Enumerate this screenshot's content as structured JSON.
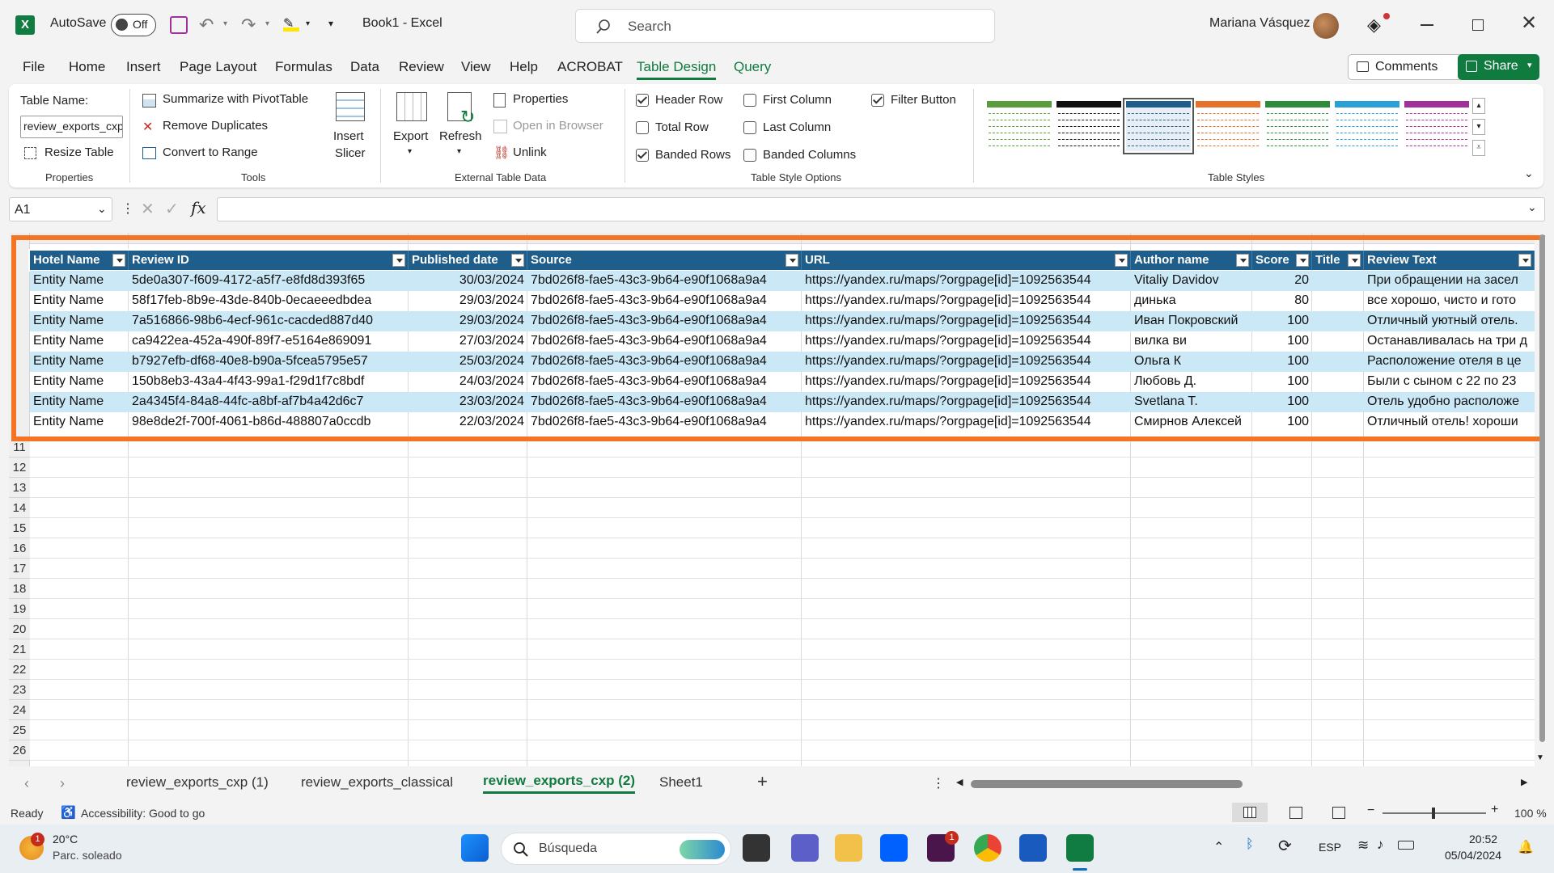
{
  "titlebar": {
    "autosave_label": "AutoSave",
    "autosave_state": "Off",
    "doc_title": "Book1  -  Excel",
    "search_placeholder": "Search",
    "user_name": "Mariana Vásquez"
  },
  "menu": {
    "items": [
      "File",
      "Home",
      "Insert",
      "Page Layout",
      "Formulas",
      "Data",
      "Review",
      "View",
      "Help",
      "ACROBAT",
      "Table Design",
      "Query"
    ],
    "active": "Table Design",
    "comments_label": "Comments",
    "share_label": "Share"
  },
  "ribbon": {
    "properties": {
      "table_name_label": "Table Name:",
      "table_name_value": "review_exports_cxp",
      "resize_label": "Resize Table",
      "group_label": "Properties"
    },
    "tools": {
      "summarize_label": "Summarize with PivotTable",
      "remove_dup_label": "Remove Duplicates",
      "convert_label": "Convert to Range",
      "insert_slicer_line1": "Insert",
      "insert_slicer_line2": "Slicer",
      "group_label": "Tools"
    },
    "external": {
      "export_label": "Export",
      "refresh_label": "Refresh",
      "properties_label": "Properties",
      "open_browser_label": "Open in Browser",
      "unlink_label": "Unlink",
      "group_label": "External Table Data"
    },
    "style_options": {
      "header_row": "Header Row",
      "total_row": "Total Row",
      "banded_rows": "Banded Rows",
      "first_column": "First Column",
      "last_column": "Last Column",
      "banded_columns": "Banded Columns",
      "filter_button": "Filter Button",
      "group_label": "Table Style Options",
      "checked": {
        "header_row": true,
        "total_row": false,
        "banded_rows": true,
        "first_column": false,
        "last_column": false,
        "banded_columns": false,
        "filter_button": true
      }
    },
    "styles": {
      "group_label": "Table Styles",
      "colors": [
        "#5a9e3c",
        "#111111",
        "#1f5e8a",
        "#e5742a",
        "#2e8b3a",
        "#2aa0d6",
        "#a0309a"
      ]
    }
  },
  "formula_bar": {
    "name_box": "A1",
    "fx": "fx",
    "formula": ""
  },
  "table": {
    "headers": [
      "Hotel Name",
      "Review ID",
      "Published date",
      "Source",
      "URL",
      "Author name",
      "Score",
      "Title",
      "Review Text"
    ],
    "rows": [
      [
        "Entity Name",
        "5de0a307-f609-4172-a5f7-e8fd8d393f65",
        "30/03/2024",
        "7bd026f8-fae5-43c3-9b64-e90f1068a9a4",
        "https://yandex.ru/maps/?orgpage[id]=1092563544",
        "Vitaliy Davidov",
        "20",
        "",
        "При обращении на засел"
      ],
      [
        "Entity Name",
        "58f17feb-8b9e-43de-840b-0ecaeeedbdea",
        "29/03/2024",
        "7bd026f8-fae5-43c3-9b64-e90f1068a9a4",
        "https://yandex.ru/maps/?orgpage[id]=1092563544",
        "динька",
        "80",
        "",
        "все хорошо, чисто и гото"
      ],
      [
        "Entity Name",
        "7a516866-98b6-4ecf-961c-cacded887d40",
        "29/03/2024",
        "7bd026f8-fae5-43c3-9b64-e90f1068a9a4",
        "https://yandex.ru/maps/?orgpage[id]=1092563544",
        "Иван Покровский",
        "100",
        "",
        "Отличный уютный отель."
      ],
      [
        "Entity Name",
        "ca9422ea-452a-490f-89f7-e5164e869091",
        "27/03/2024",
        "7bd026f8-fae5-43c3-9b64-e90f1068a9a4",
        "https://yandex.ru/maps/?orgpage[id]=1092563544",
        "вилка ви",
        "100",
        "",
        "Останавливалась на три д"
      ],
      [
        "Entity Name",
        "b7927efb-df68-40e8-b90a-5fcea5795e57",
        "25/03/2024",
        "7bd026f8-fae5-43c3-9b64-e90f1068a9a4",
        "https://yandex.ru/maps/?orgpage[id]=1092563544",
        "Ольга К",
        "100",
        "",
        "Расположение отеля в це"
      ],
      [
        "Entity Name",
        "150b8eb3-43a4-4f43-99a1-f29d1f7c8bdf",
        "24/03/2024",
        "7bd026f8-fae5-43c3-9b64-e90f1068a9a4",
        "https://yandex.ru/maps/?orgpage[id]=1092563544",
        "Любовь Д.",
        "100",
        "",
        "Были с сыном с 22 по 23"
      ],
      [
        "Entity Name",
        "2a4345f4-84a8-44fc-a8bf-af7b4a42d6c7",
        "23/03/2024",
        "7bd026f8-fae5-43c3-9b64-e90f1068a9a4",
        "https://yandex.ru/maps/?orgpage[id]=1092563544",
        "Svetlana T.",
        "100",
        "",
        "Отель удобно расположе"
      ],
      [
        "Entity Name",
        "98e8de2f-700f-4061-b86d-488807a0ccdb",
        "22/03/2024",
        "7bd026f8-fae5-43c3-9b64-e90f1068a9a4",
        "https://yandex.ru/maps/?orgpage[id]=1092563544",
        "Смирнов Алексей",
        "100",
        "",
        "Отличный отель! хороши"
      ]
    ],
    "visible_row_numbers": [
      "11",
      "12",
      "13",
      "14",
      "15",
      "16",
      "17",
      "18",
      "19",
      "20",
      "21",
      "22",
      "23",
      "24",
      "25",
      "26"
    ]
  },
  "sheet_tabs": {
    "tabs": [
      "review_exports_cxp (1)",
      "review_exports_classical",
      "review_exports_cxp (2)",
      "Sheet1"
    ],
    "active": "review_exports_cxp (2)",
    "add_label": "+"
  },
  "status": {
    "ready": "Ready",
    "accessibility": "Accessibility: Good to go",
    "zoom": "100 %"
  },
  "taskbar": {
    "weather_temp": "20°C",
    "weather_desc": "Parc. soleado",
    "weather_badge": "1",
    "search_placeholder": "Búsqueda",
    "slack_badge": "1",
    "lang": "ESP",
    "time": "20:52",
    "date": "05/04/2024"
  }
}
